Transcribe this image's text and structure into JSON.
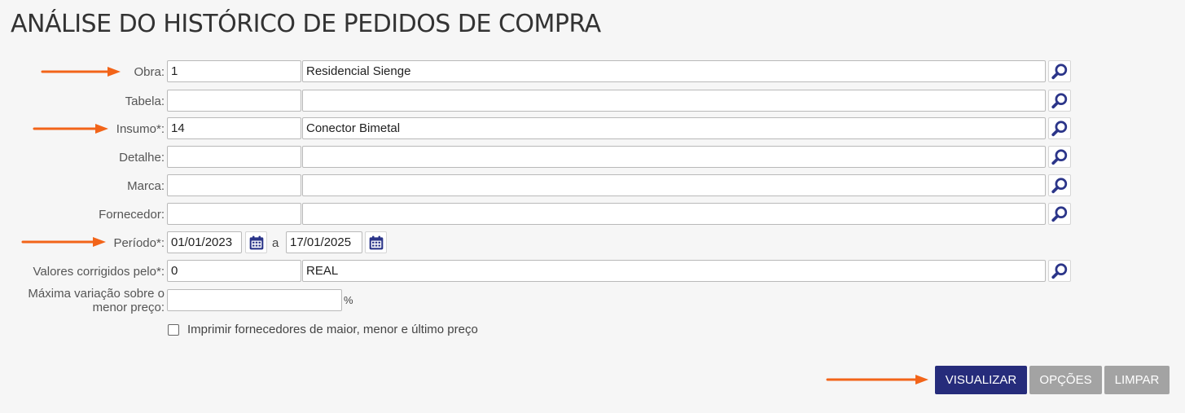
{
  "page": {
    "title": "ANÁLISE DO HISTÓRICO DE PEDIDOS DE COMPRA"
  },
  "fields": {
    "obra": {
      "label": "Obra:",
      "code": "1",
      "description": "Residencial Sienge"
    },
    "tabela": {
      "label": "Tabela:",
      "code": "",
      "description": ""
    },
    "insumo": {
      "label": "Insumo*:",
      "code": "14",
      "description": "Conector Bimetal"
    },
    "detalhe": {
      "label": "Detalhe:",
      "code": "",
      "description": ""
    },
    "marca": {
      "label": "Marca:",
      "code": "",
      "description": ""
    },
    "fornecedor": {
      "label": "Fornecedor:",
      "code": "",
      "description": ""
    },
    "periodo": {
      "label": "Período*:",
      "start": "01/01/2023",
      "separator": "a",
      "end": "17/01/2025"
    },
    "valores": {
      "label": "Valores corrigidos pelo*:",
      "code": "0",
      "description": "REAL"
    },
    "variacao": {
      "label_line1": "Máxima variação sobre o",
      "label_line2": "menor preço:",
      "value": "",
      "unit": "%"
    }
  },
  "checkbox": {
    "label": "Imprimir fornecedores de maior, menor e último preço",
    "checked": false
  },
  "buttons": {
    "visualizar": "VISUALIZAR",
    "opcoes": "OPÇÕES",
    "limpar": "LIMPAR"
  },
  "colors": {
    "primary": "#262c7b",
    "disabled": "#a3a3a3",
    "arrow": "#f26419",
    "icon": "#2b3589"
  },
  "icons": {
    "lookup": "search-icon",
    "calendar": "calendar-icon",
    "annotation": "arrow-right-icon"
  }
}
